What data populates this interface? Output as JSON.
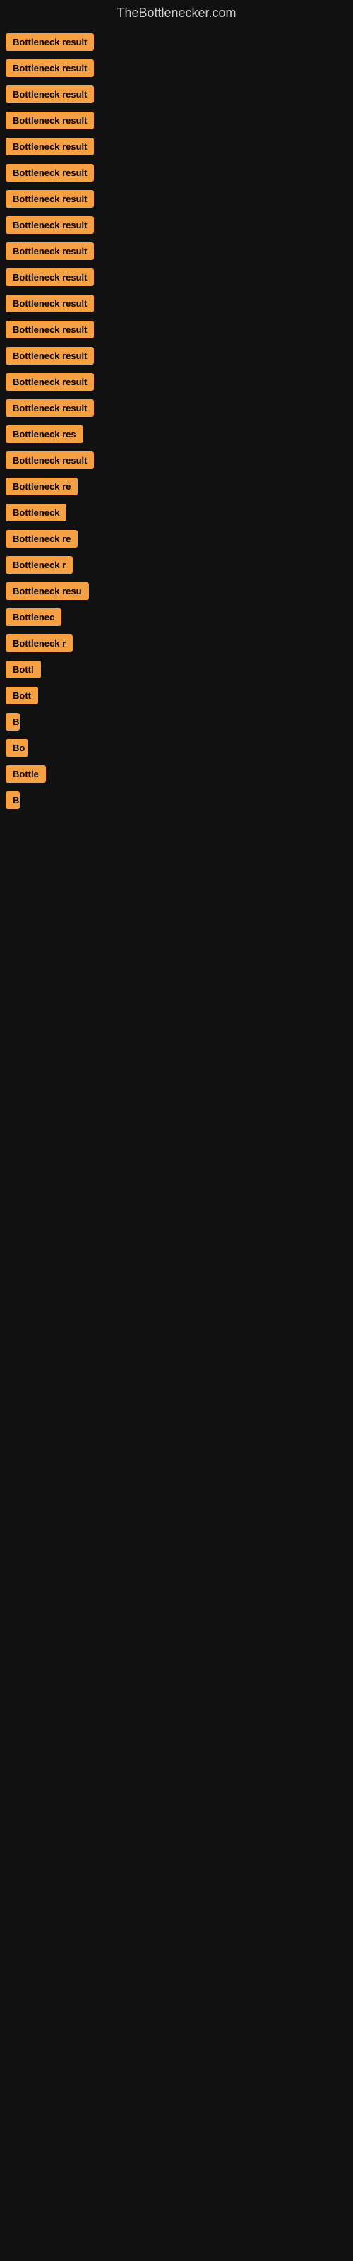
{
  "site": {
    "title": "TheBottlenecker.com"
  },
  "items": [
    {
      "label": "Bottleneck result",
      "width": 145
    },
    {
      "label": "Bottleneck result",
      "width": 145
    },
    {
      "label": "Bottleneck result",
      "width": 145
    },
    {
      "label": "Bottleneck result",
      "width": 145
    },
    {
      "label": "Bottleneck result",
      "width": 145
    },
    {
      "label": "Bottleneck result",
      "width": 145
    },
    {
      "label": "Bottleneck result",
      "width": 145
    },
    {
      "label": "Bottleneck result",
      "width": 145
    },
    {
      "label": "Bottleneck result",
      "width": 145
    },
    {
      "label": "Bottleneck result",
      "width": 145
    },
    {
      "label": "Bottleneck result",
      "width": 145
    },
    {
      "label": "Bottleneck result",
      "width": 145
    },
    {
      "label": "Bottleneck result",
      "width": 145
    },
    {
      "label": "Bottleneck result",
      "width": 145
    },
    {
      "label": "Bottleneck result",
      "width": 145
    },
    {
      "label": "Bottleneck res",
      "width": 120
    },
    {
      "label": "Bottleneck result",
      "width": 145
    },
    {
      "label": "Bottleneck re",
      "width": 110
    },
    {
      "label": "Bottleneck",
      "width": 90
    },
    {
      "label": "Bottleneck re",
      "width": 110
    },
    {
      "label": "Bottleneck r",
      "width": 100
    },
    {
      "label": "Bottleneck resu",
      "width": 125
    },
    {
      "label": "Bottlenec",
      "width": 85
    },
    {
      "label": "Bottleneck r",
      "width": 100
    },
    {
      "label": "Bottl",
      "width": 55
    },
    {
      "label": "Bott",
      "width": 50
    },
    {
      "label": "B",
      "width": 20
    },
    {
      "label": "Bo",
      "width": 32
    },
    {
      "label": "Bottle",
      "width": 58
    },
    {
      "label": "B",
      "width": 18
    }
  ],
  "colors": {
    "badge_bg": "#f5a043",
    "badge_text": "#000000",
    "bg": "#111111",
    "title": "#cccccc"
  }
}
